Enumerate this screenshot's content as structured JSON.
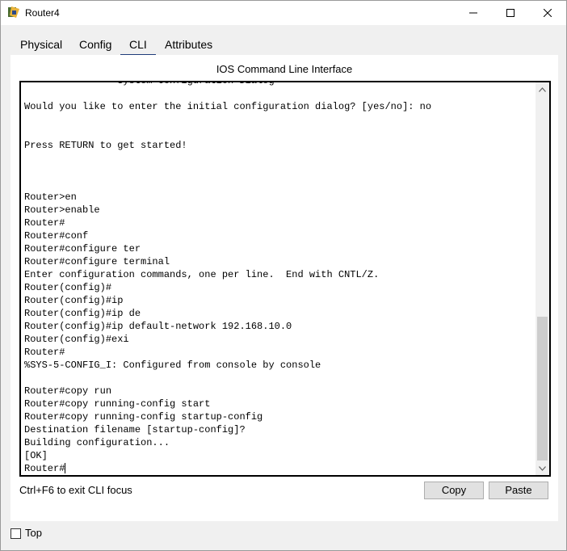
{
  "window": {
    "title": "Router4"
  },
  "tabs": [
    {
      "label": "Physical"
    },
    {
      "label": "Config"
    },
    {
      "label": "CLI"
    },
    {
      "label": "Attributes"
    }
  ],
  "active_tab": "CLI",
  "panel": {
    "title": "IOS Command Line Interface"
  },
  "console": {
    "lines": [
      "                System Configuration Dialog",
      "",
      "Would you like to enter the initial configuration dialog? [yes/no]: no",
      "",
      "",
      "Press RETURN to get started!",
      "",
      "",
      "",
      "Router>en",
      "Router>enable",
      "Router#",
      "Router#conf",
      "Router#configure ter",
      "Router#configure terminal",
      "Enter configuration commands, one per line.  End with CNTL/Z.",
      "Router(config)#",
      "Router(config)#ip",
      "Router(config)#ip de",
      "Router(config)#ip default-network 192.168.10.0",
      "Router(config)#exi",
      "Router#",
      "%SYS-5-CONFIG_I: Configured from console by console",
      "",
      "Router#copy run",
      "Router#copy running-config start",
      "Router#copy running-config startup-config",
      "Destination filename [startup-config]?",
      "Building configuration...",
      "[OK]",
      "Router#"
    ]
  },
  "footer": {
    "hint": "Ctrl+F6 to exit CLI focus",
    "copy_label": "Copy",
    "paste_label": "Paste"
  },
  "top_checkbox": {
    "label": "Top",
    "checked": false
  }
}
